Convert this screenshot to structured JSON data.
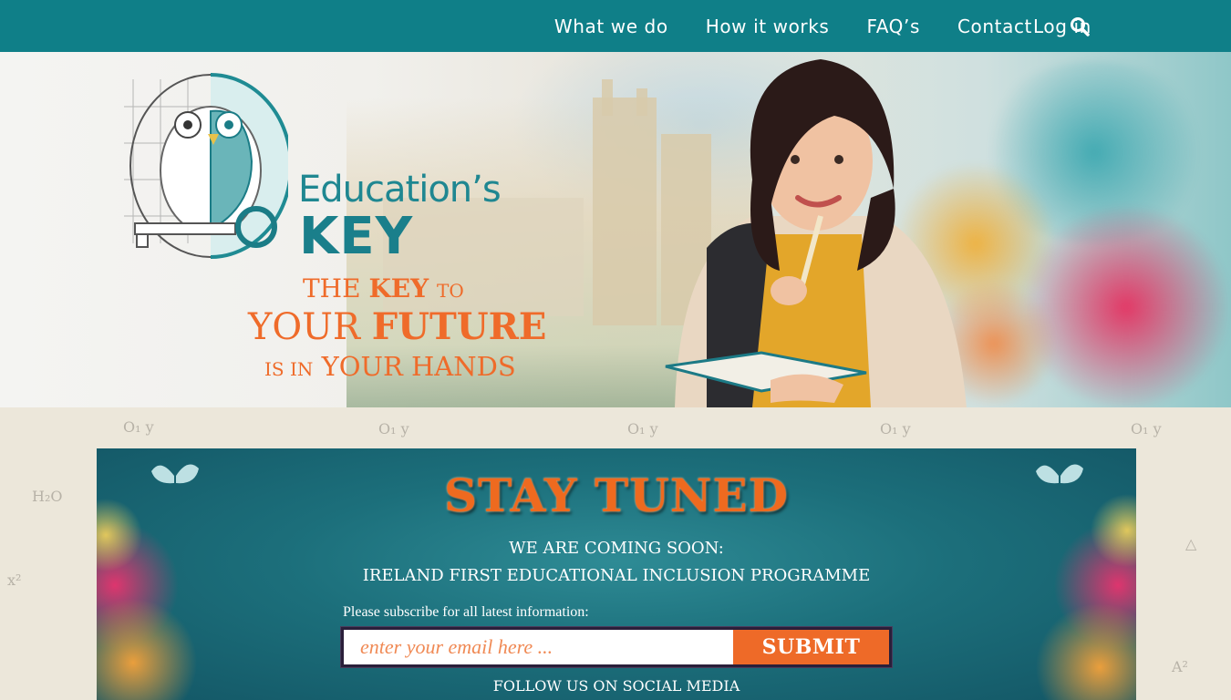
{
  "nav": {
    "items": [
      {
        "label": "What we do"
      },
      {
        "label": "How it works"
      },
      {
        "label": "FAQ’s"
      },
      {
        "label": "Contact"
      }
    ],
    "search_icon": "search-icon",
    "login_label": "Log in",
    "color": "#0f7f88"
  },
  "hero": {
    "brand_line1": "Education’s",
    "brand_line2": "KEY",
    "tagline": {
      "l1a": "THE",
      "l1b": "KEY",
      "l1c": "TO",
      "l2a": "YOUR",
      "l2b": "FUTURE",
      "l3a": "IS IN",
      "l3b": "YOUR HANDS"
    },
    "accent_color": "#ef6b2a",
    "brand_color": "#1f8791"
  },
  "signup": {
    "heading": "STAY TUNED",
    "line1": "WE ARE COMING SOON:",
    "line2": "IRELAND FIRST EDUCATIONAL INCLUSION PROGRAMME",
    "subscribe_label": "Please subscribe for all latest information:",
    "email_placeholder": "enter your email here ...",
    "submit_label": "SUBMIT",
    "follow_label": "FOLLOW US ON SOCIAL MEDIA"
  }
}
